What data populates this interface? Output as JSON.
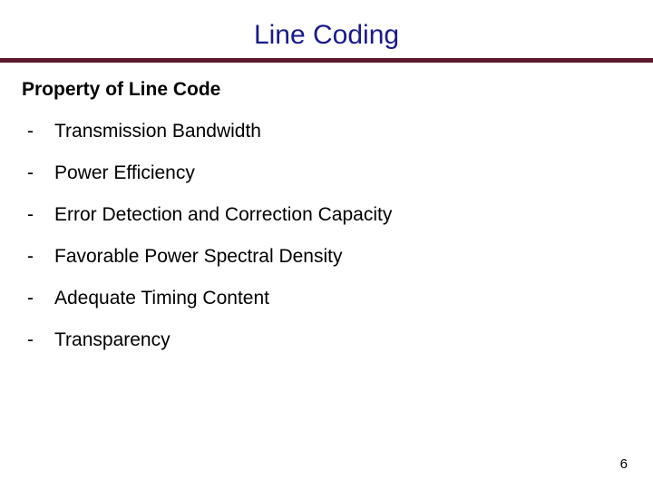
{
  "title": "Line Coding",
  "subtitle": "Property of Line Code",
  "items": [
    {
      "text": "Transmission Bandwidth"
    },
    {
      "text": "Power Efficiency"
    },
    {
      "text": "Error Detection and Correction Capacity"
    },
    {
      "text": "Favorable Power Spectral Density"
    },
    {
      "text": "Adequate Timing Content"
    },
    {
      "text": "Transparency"
    }
  ],
  "page_number": "6",
  "dash": "-"
}
